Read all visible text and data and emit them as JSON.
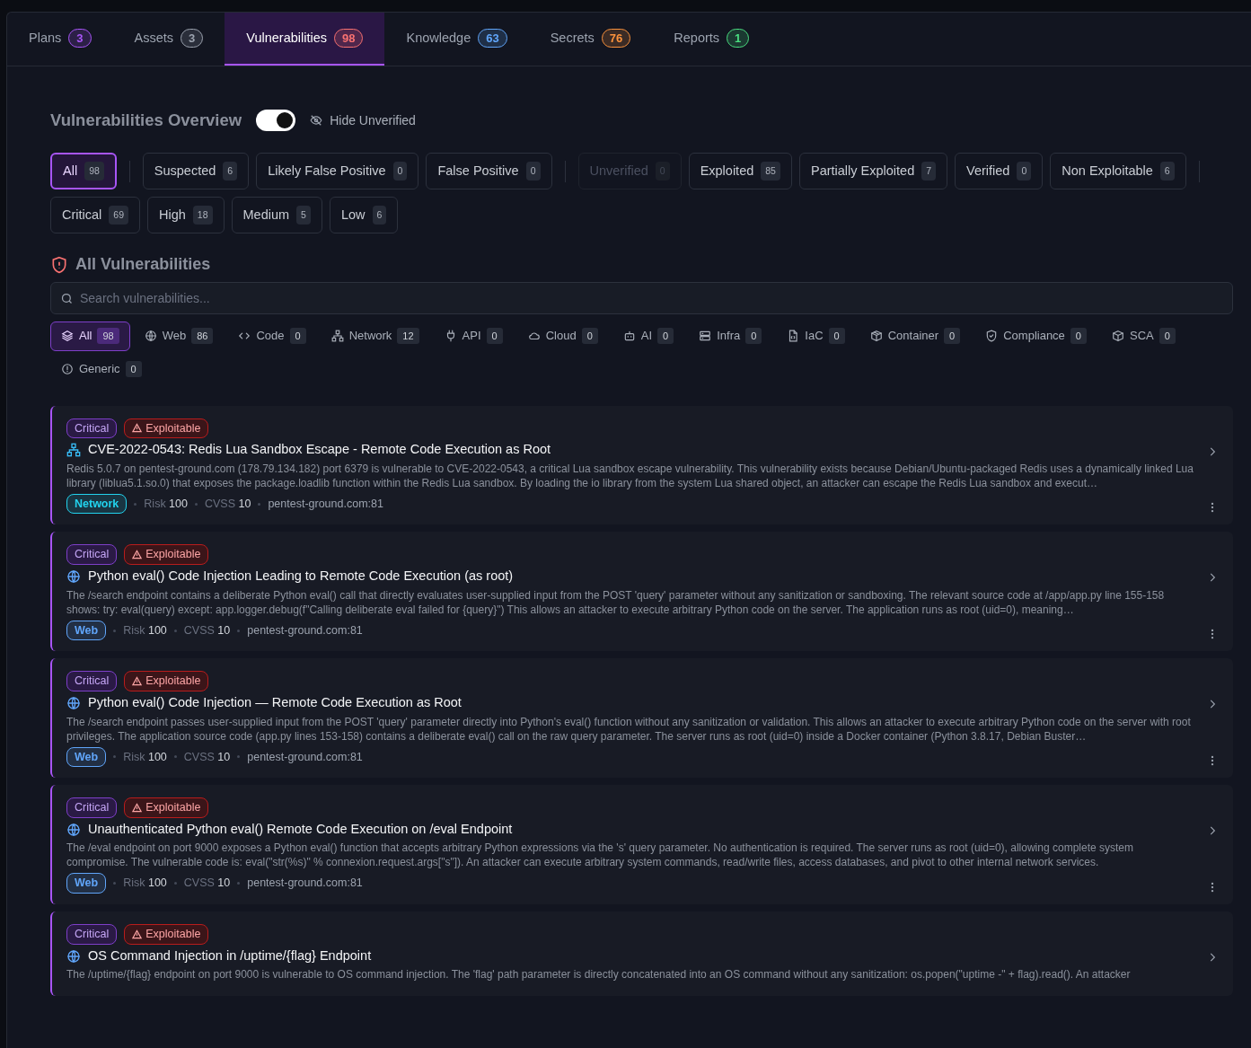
{
  "tabs": [
    {
      "label": "Plans",
      "count": "3",
      "color": "#a855f7",
      "selected": false
    },
    {
      "label": "Assets",
      "count": "3",
      "color": "#9ca3af",
      "selected": false
    },
    {
      "label": "Vulnerabilities",
      "count": "98",
      "color": "#f87171",
      "selected": true
    },
    {
      "label": "Knowledge",
      "count": "63",
      "color": "#60a5fa",
      "selected": false
    },
    {
      "label": "Secrets",
      "count": "76",
      "color": "#fb923c",
      "selected": false
    },
    {
      "label": "Reports",
      "count": "1",
      "color": "#4ade80",
      "selected": false
    }
  ],
  "overview": {
    "title": "Vulnerabilities Overview",
    "hide_unverified": {
      "label": "Hide Unverified",
      "on": true
    }
  },
  "status_filter_groups": [
    [
      {
        "label": "All",
        "count": "98",
        "selected": true,
        "disabled": false
      }
    ],
    [
      {
        "label": "Suspected",
        "count": "6",
        "selected": false,
        "disabled": false
      },
      {
        "label": "Likely False Positive",
        "count": "0",
        "selected": false,
        "disabled": false
      },
      {
        "label": "False Positive",
        "count": "0",
        "selected": false,
        "disabled": false
      }
    ],
    [
      {
        "label": "Unverified",
        "count": "0",
        "selected": false,
        "disabled": true
      },
      {
        "label": "Exploited",
        "count": "85",
        "selected": false,
        "disabled": false
      },
      {
        "label": "Partially Exploited",
        "count": "7",
        "selected": false,
        "disabled": false
      },
      {
        "label": "Verified",
        "count": "0",
        "selected": false,
        "disabled": false
      },
      {
        "label": "Non Exploitable",
        "count": "6",
        "selected": false,
        "disabled": false
      }
    ]
  ],
  "severity_filters": [
    {
      "label": "Critical",
      "count": "69",
      "selected": false
    },
    {
      "label": "High",
      "count": "18",
      "selected": false
    },
    {
      "label": "Medium",
      "count": "5",
      "selected": false
    },
    {
      "label": "Low",
      "count": "6",
      "selected": false
    }
  ],
  "list": {
    "title": "All Vulnerabilities",
    "search": {
      "placeholder": "Search vulnerabilities..."
    }
  },
  "categories": [
    {
      "kind": "layers",
      "label": "All",
      "count": "98",
      "selected": true
    },
    {
      "kind": "globe",
      "label": "Web",
      "count": "86",
      "selected": false
    },
    {
      "kind": "code",
      "label": "Code",
      "count": "0",
      "selected": false
    },
    {
      "kind": "network",
      "label": "Network",
      "count": "12",
      "selected": false
    },
    {
      "kind": "plug",
      "label": "API",
      "count": "0",
      "selected": false
    },
    {
      "kind": "cloud",
      "label": "Cloud",
      "count": "0",
      "selected": false
    },
    {
      "kind": "robot",
      "label": "AI",
      "count": "0",
      "selected": false
    },
    {
      "kind": "server",
      "label": "Infra",
      "count": "0",
      "selected": false
    },
    {
      "kind": "file",
      "label": "IaC",
      "count": "0",
      "selected": false
    },
    {
      "kind": "container",
      "label": "Container",
      "count": "0",
      "selected": false
    },
    {
      "kind": "shield",
      "label": "Compliance",
      "count": "0",
      "selected": false
    },
    {
      "kind": "cube",
      "label": "SCA",
      "count": "0",
      "selected": false
    },
    {
      "kind": "info",
      "label": "Generic",
      "count": "0",
      "selected": false
    }
  ],
  "vulnerabilities": [
    {
      "severity": "Critical",
      "status": "Exploitable",
      "kind": "network",
      "title": "CVE-2022-0543: Redis Lua Sandbox Escape - Remote Code Execution as Root",
      "description": "Redis 5.0.7 on pentest-ground.com (178.79.134.182) port 6379 is vulnerable to CVE-2022-0543, a critical Lua sandbox escape vulnerability. This vulnerability exists because Debian/Ubuntu-packaged Redis uses a dynamically linked Lua library (liblua5.1.so.0) that exposes the package.loadlib function within the Redis Lua sandbox. By loading the io library from the system Lua shared object, an attacker can escape the Redis Lua sandbox and execut…",
      "category": {
        "label": "Network",
        "color": "#22d3ee"
      },
      "risk_label": "Risk",
      "risk": "100",
      "cvss_label": "CVSS",
      "cvss": "10",
      "host": "pentest-ground.com:81"
    },
    {
      "severity": "Critical",
      "status": "Exploitable",
      "kind": "globe",
      "title": "Python eval() Code Injection Leading to Remote Code Execution (as root)",
      "description": "The /search endpoint contains a deliberate Python eval() call that directly evaluates user-supplied input from the POST 'query' parameter without any sanitization or sandboxing. The relevant source code at /app/app.py line 155-158 shows: try: eval(query) except: app.logger.debug(f\"Calling deliberate eval failed for {query}\") This allows an attacker to execute arbitrary Python code on the server. The application runs as root (uid=0), meaning…",
      "category": {
        "label": "Web",
        "color": "#60a5fa"
      },
      "risk_label": "Risk",
      "risk": "100",
      "cvss_label": "CVSS",
      "cvss": "10",
      "host": "pentest-ground.com:81"
    },
    {
      "severity": "Critical",
      "status": "Exploitable",
      "kind": "globe",
      "title": "Python eval() Code Injection — Remote Code Execution as Root",
      "description": "The /search endpoint passes user-supplied input from the POST 'query' parameter directly into Python's eval() function without any sanitization or validation. This allows an attacker to execute arbitrary Python code on the server with root privileges. The application source code (app.py lines 153-158) contains a deliberate eval() call on the raw query parameter. The server runs as root (uid=0) inside a Docker container (Python 3.8.17, Debian Buster…",
      "category": {
        "label": "Web",
        "color": "#60a5fa"
      },
      "risk_label": "Risk",
      "risk": "100",
      "cvss_label": "CVSS",
      "cvss": "10",
      "host": "pentest-ground.com:81"
    },
    {
      "severity": "Critical",
      "status": "Exploitable",
      "kind": "globe",
      "title": "Unauthenticated Python eval() Remote Code Execution on /eval Endpoint",
      "description": "The /eval endpoint on port 9000 exposes a Python eval() function that accepts arbitrary Python expressions via the 's' query parameter. No authentication is required. The server runs as root (uid=0), allowing complete system compromise. The vulnerable code is: eval(\"str(%s)\" % connexion.request.args[\"s\"]). An attacker can execute arbitrary system commands, read/write files, access databases, and pivot to other internal network services.",
      "category": {
        "label": "Web",
        "color": "#60a5fa"
      },
      "risk_label": "Risk",
      "risk": "100",
      "cvss_label": "CVSS",
      "cvss": "10",
      "host": "pentest-ground.com:81"
    },
    {
      "severity": "Critical",
      "status": "Exploitable",
      "kind": "globe",
      "title": "OS Command Injection in /uptime/{flag} Endpoint",
      "description": "The /uptime/{flag} endpoint on port 9000 is vulnerable to OS command injection. The 'flag' path parameter is directly concatenated into an OS command without any sanitization: os.popen(\"uptime -\" + flag).read(). An attacker"
    }
  ]
}
